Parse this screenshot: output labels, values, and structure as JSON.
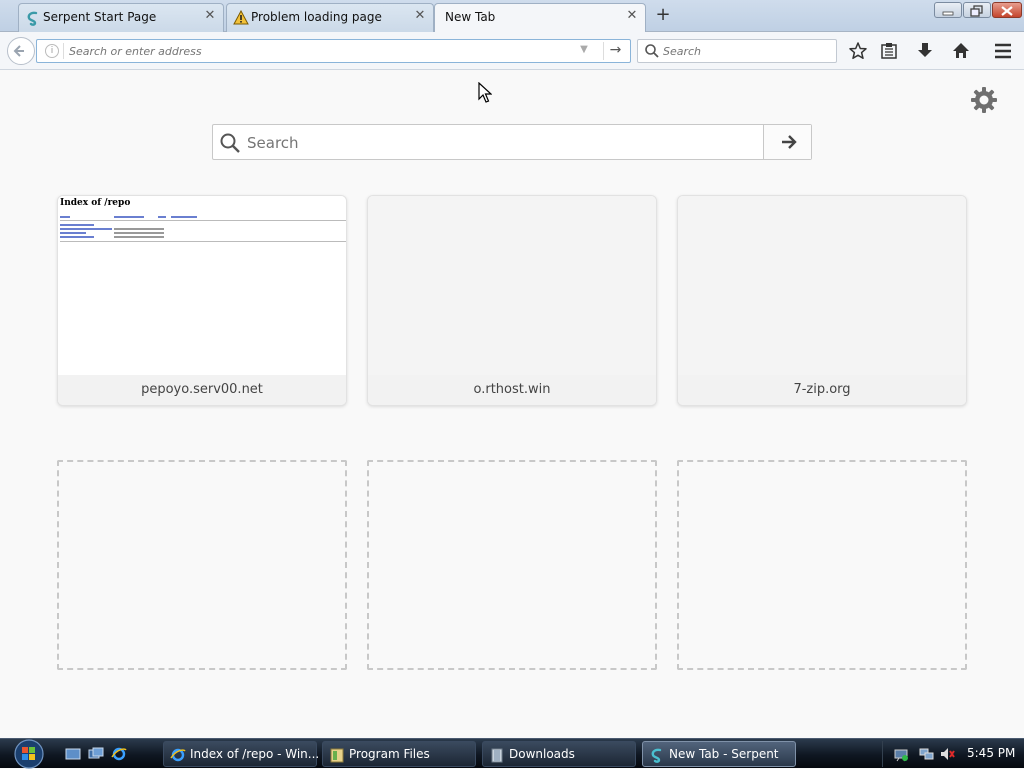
{
  "browser": {
    "tabs": [
      {
        "label": "Serpent Start Page",
        "icon": "serpent-icon",
        "active": false
      },
      {
        "label": "Problem loading page",
        "icon": "warning-icon",
        "active": false
      },
      {
        "label": "New Tab",
        "icon": "",
        "active": true
      }
    ],
    "urlbar": {
      "placeholder": "Search or enter address",
      "value": ""
    },
    "searchbar": {
      "placeholder": "Search"
    },
    "toolbar_icons": [
      "bookmark-star-icon",
      "reading-list-icon",
      "download-icon",
      "home-icon",
      "menu-icon"
    ]
  },
  "newtab": {
    "search": {
      "placeholder": "Search"
    },
    "tiles": [
      {
        "label": "pepoyo.serv00.net",
        "thumb_title": "Index of /repo"
      },
      {
        "label": "o.rthost.win"
      },
      {
        "label": "7-zip.org"
      }
    ],
    "placeholder_count": 3
  },
  "taskbar": {
    "quick_launch": [
      "show-desktop-icon",
      "switch-windows-icon",
      "ie-icon"
    ],
    "tasks": [
      {
        "label": "Index of /repo - Win...",
        "icon": "ie-icon",
        "active": false
      },
      {
        "label": "Program Files",
        "icon": "folder-icon",
        "active": false
      },
      {
        "label": "Downloads",
        "icon": "folder-icon",
        "active": false
      },
      {
        "label": "New Tab - Serpent",
        "icon": "serpent-icon",
        "active": true
      }
    ],
    "clock": "5:45 PM"
  },
  "colors": {
    "urlbar_focus": "#8ab4d9",
    "page_bg": "#f9f9f9",
    "taskbar": "#0f1722"
  }
}
